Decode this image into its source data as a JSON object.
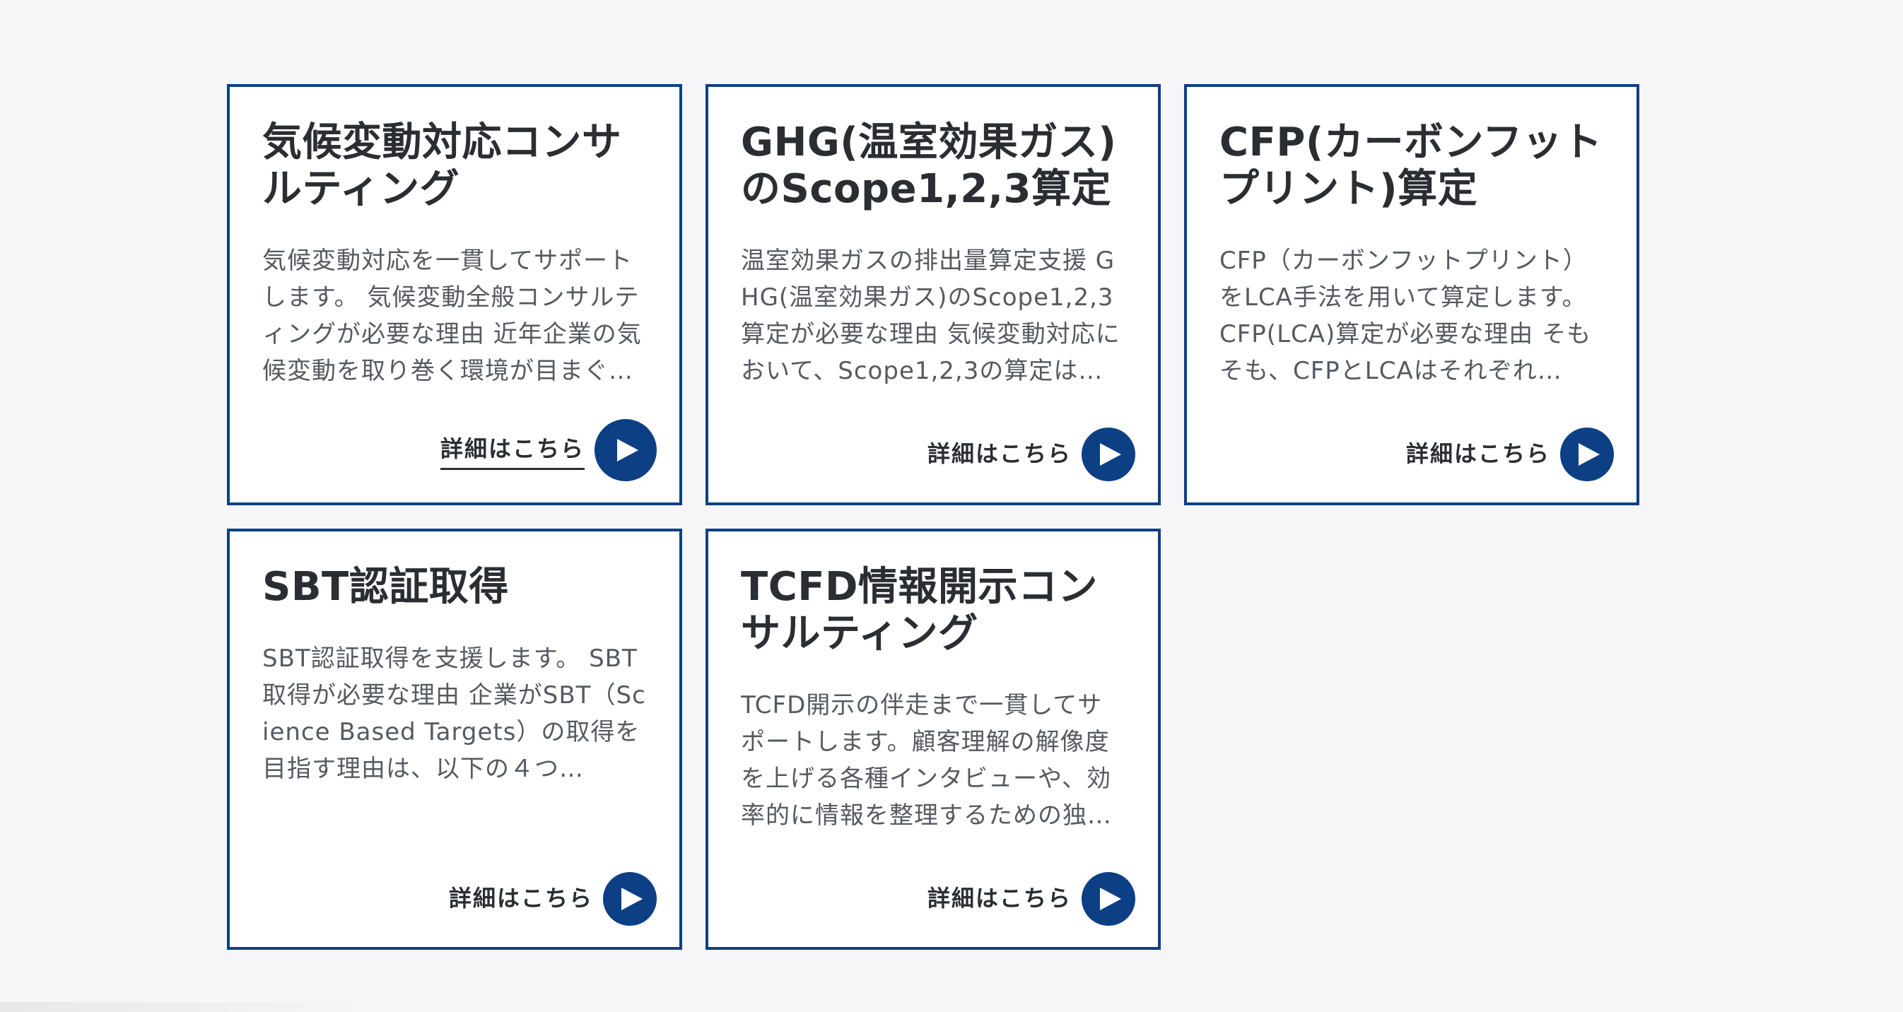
{
  "colors": {
    "background": "#f6f6f8",
    "card_border": "#0d3f85",
    "accent": "#0d3f85",
    "title_text": "#2a2e33",
    "body_text": "#555a60"
  },
  "cards": [
    {
      "title": "気候変動対応コンサルティング",
      "description": "気候変動対応を一貫してサポートします。 気候変動全般コンサルティングが必要な理由 近年企業の気候変動を取り巻く環境が目まぐ…",
      "link_label": "詳細はこちら",
      "link_icon": "play-icon"
    },
    {
      "title": "GHG(温室効果ガス)のScope1,2,3算定",
      "description": "温室効果ガスの排出量算定支援 GHG(温室効果ガス)のScope1,2,3算定が必要な理由 気候変動対応において、Scope1,2,3の算定は様…",
      "link_label": "詳細はこちら",
      "link_icon": "play-icon"
    },
    {
      "title": "CFP(カーボンフットプリント)算定",
      "description": "CFP（カーボンフットプリント）をLCA手法を用いて算定します。 CFP(LCA)算定が必要な理由 そもそも、CFPとLCAはそれぞれ…",
      "link_label": "詳細はこちら",
      "link_icon": "play-icon"
    },
    {
      "title": "SBT認証取得",
      "description": "SBT認証取得を支援します。 SBT取得が必要な理由 企業がSBT（Science Based Targets）の取得を目指す理由は、以下の４つ…",
      "link_label": "詳細はこちら",
      "link_icon": "play-icon"
    },
    {
      "title": "TCFD情報開示コンサルティング",
      "description": "TCFD開示の伴走まで一貫してサポートします。顧客理解の解像度を上げる各種インタビューや、効率的に情報を整理するための独…",
      "link_label": "詳細はこちら",
      "link_icon": "play-icon"
    }
  ]
}
